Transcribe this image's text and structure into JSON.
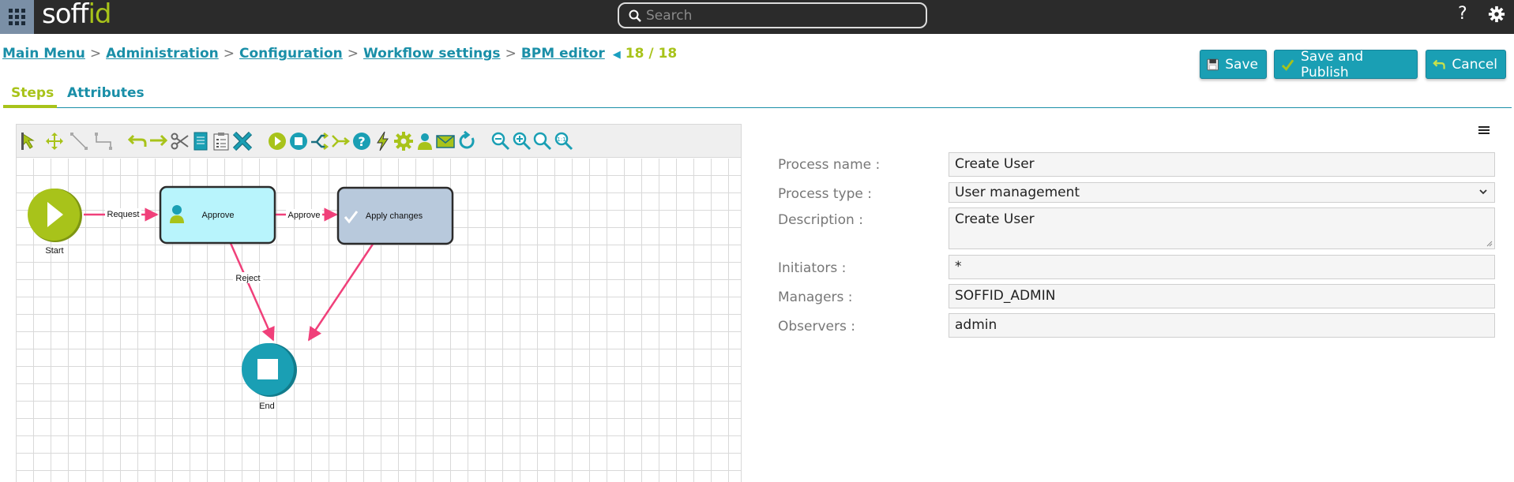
{
  "topbar": {
    "logo_main": "so",
    "logo_ff": "ff",
    "logo_end": "id",
    "search_placeholder": "Search",
    "help_label": "?"
  },
  "breadcrumb": {
    "items": [
      "Main Menu",
      "Administration",
      "Configuration",
      "Workflow settings",
      "BPM editor"
    ],
    "separator": ">",
    "pager": "18 / 18"
  },
  "actions": {
    "save": "Save",
    "save_publish": "Save and Publish",
    "cancel": "Cancel"
  },
  "tabs": {
    "steps": "Steps",
    "attributes": "Attributes"
  },
  "toolbar_icons": [
    "select-arrow-icon",
    "move-icon",
    "connect-line-icon",
    "elbow-connector-icon",
    "undo-icon",
    "redo-icon",
    "cut-icon",
    "copy-icon",
    "paste-icon",
    "delete-icon",
    "start-node-icon",
    "end-node-icon",
    "fork-icon",
    "join-icon",
    "decision-icon",
    "action-icon",
    "system-task-icon",
    "user-task-icon",
    "mail-icon",
    "loop-icon",
    "zoom-out-icon",
    "zoom-in-icon",
    "zoom-actual-icon",
    "zoom-fit-icon"
  ],
  "diagram": {
    "start_label": "Start",
    "end_label": "End",
    "approve_label": "Approve",
    "apply_label": "Apply changes",
    "edge_request": "Request",
    "edge_approve": "Approve",
    "edge_reject": "Reject"
  },
  "form": {
    "process_name_label": "Process name :",
    "process_name_value": "Create User",
    "process_type_label": "Process type :",
    "process_type_value": "User management",
    "description_label": "Description :",
    "description_value": "Create User",
    "initiators_label": "Initiators :",
    "initiators_value": "*",
    "managers_label": "Managers :",
    "managers_value": "SOFFID_ADMIN",
    "observers_label": "Observers :",
    "observers_value": "admin"
  },
  "colors": {
    "accent_green": "#a8c31a",
    "accent_teal": "#1a9fb4",
    "edge_pink": "#f0407a",
    "task_cyan": "#b8f4fc",
    "task_grayblue": "#b8c9dc"
  }
}
